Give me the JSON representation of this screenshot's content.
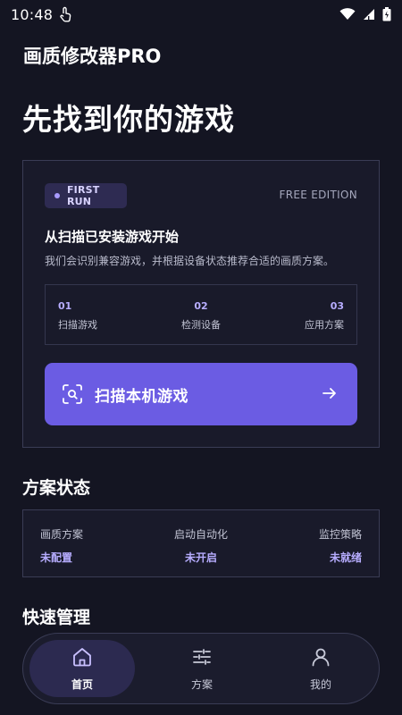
{
  "status_bar": {
    "time": "10:48"
  },
  "app": {
    "title": "画质修改器PRO",
    "page_title": "先找到你的游戏"
  },
  "main_card": {
    "badge": "FIRST RUN",
    "edition": "FREE EDITION",
    "heading": "从扫描已安装游戏开始",
    "description": "我们会识别兼容游戏，并根据设备状态推荐合适的画质方案。",
    "steps": [
      {
        "num": "01",
        "label": "扫描游戏"
      },
      {
        "num": "02",
        "label": "检测设备"
      },
      {
        "num": "03",
        "label": "应用方案"
      }
    ],
    "scan_button": "扫描本机游戏"
  },
  "plan_status": {
    "title": "方案状态",
    "items": [
      {
        "label": "画质方案",
        "value": "未配置"
      },
      {
        "label": "启动自动化",
        "value": "未开启"
      },
      {
        "label": "监控策略",
        "value": "未就绪"
      }
    ]
  },
  "quick_manage": {
    "title": "快速管理"
  },
  "bottom_nav": {
    "items": [
      {
        "label": "首页",
        "icon": "home-icon",
        "active": true
      },
      {
        "label": "方案",
        "icon": "sliders-icon",
        "active": false
      },
      {
        "label": "我的",
        "icon": "user-icon",
        "active": false
      }
    ]
  },
  "colors": {
    "background": "#141522",
    "accent": "#6b5ce3",
    "accent_text": "#b7adff"
  }
}
